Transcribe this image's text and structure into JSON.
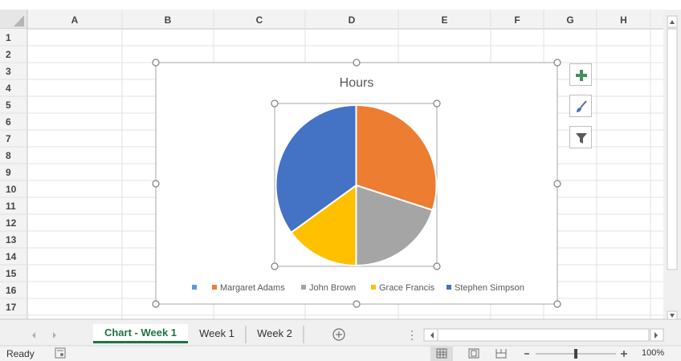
{
  "columns": [
    "A",
    "B",
    "C",
    "D",
    "E",
    "F",
    "G",
    "H"
  ],
  "rows": [
    "1",
    "2",
    "3",
    "4",
    "5",
    "6",
    "7",
    "8",
    "9",
    "10",
    "11",
    "12",
    "13",
    "14",
    "15",
    "16",
    "17"
  ],
  "chart_data": {
    "type": "pie",
    "title": "Hours",
    "categories": [
      "",
      "Margaret Adams",
      "John Brown",
      "Grace Francis",
      "Stephen Simpson"
    ],
    "values": [
      0,
      30,
      20,
      15,
      35
    ],
    "colors": [
      "#5b9bd5",
      "#ed7d31",
      "#a5a5a5",
      "#ffc000",
      "#4472c4"
    ],
    "legend_position": "bottom"
  },
  "chart_buttons": [
    {
      "name": "chart-elements-plus-icon",
      "label": "Chart Elements"
    },
    {
      "name": "chart-styles-brush-icon",
      "label": "Chart Styles"
    },
    {
      "name": "chart-filters-funnel-icon",
      "label": "Chart Filters"
    }
  ],
  "tabs": [
    {
      "label": "Chart - Week 1",
      "active": true
    },
    {
      "label": "Week 1",
      "active": false
    },
    {
      "label": "Week 2",
      "active": false
    }
  ],
  "status": {
    "ready": "Ready",
    "zoom": "100%"
  }
}
